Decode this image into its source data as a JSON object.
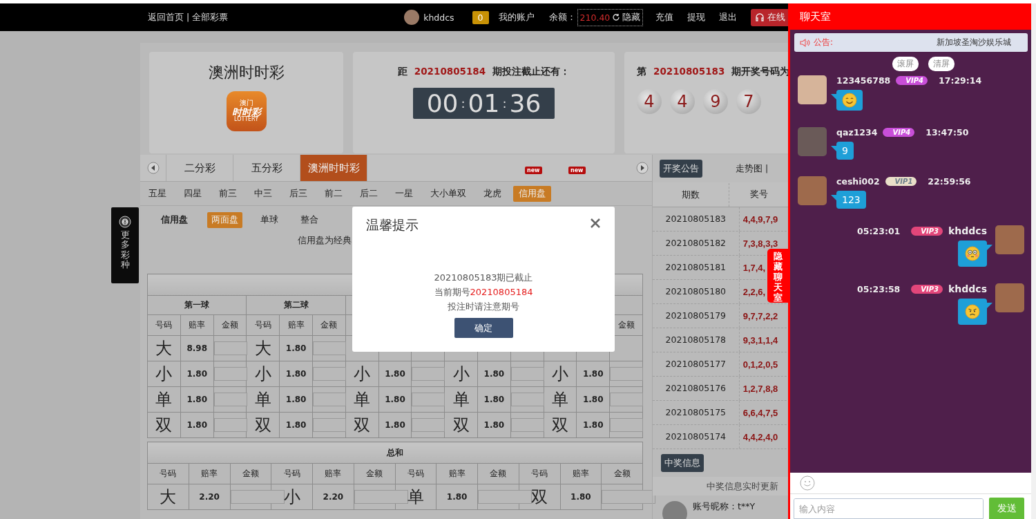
{
  "topbar": {
    "links": "返回首页 | 全部彩票",
    "username": "khddcs",
    "message_count": "0",
    "account_menu": "我的账户",
    "balance_label": "余额：",
    "balance": "210.40",
    "hide_balance": "隐藏",
    "actions": [
      "充值",
      "提现",
      "退出"
    ],
    "service_button": "在线"
  },
  "side_float": {
    "label": "更多彩种"
  },
  "game": {
    "name": "澳洲时时彩",
    "logo": {
      "top": "澳门",
      "main": "时时彩",
      "sub": "LOTTERY"
    }
  },
  "countdown": {
    "prefix": "距",
    "period": "20210805184",
    "suffix": "期投注截止还有：",
    "timer": [
      {
        "kind": "digits",
        "text": "00"
      },
      {
        "kind": "colon",
        "text": ":"
      },
      {
        "kind": "digits",
        "text": "01"
      },
      {
        "kind": "colon",
        "text": ":"
      },
      {
        "kind": "digits",
        "text": "36"
      }
    ]
  },
  "last_draw": {
    "prefix": "第",
    "period": "20210805183",
    "suffix": "期开奖号码为",
    "balls": [
      "4",
      "4",
      "9",
      "7"
    ]
  },
  "lottery_tabs": [
    {
      "label": "二分彩",
      "selected": false
    },
    {
      "label": "五分彩",
      "selected": false
    },
    {
      "label": "澳洲时时彩",
      "selected": true
    }
  ],
  "new_badges": [
    "new",
    "new"
  ],
  "play_tabs": [
    {
      "label": "五星",
      "selected": false
    },
    {
      "label": "四星",
      "selected": false
    },
    {
      "label": "前三",
      "selected": false
    },
    {
      "label": "中三",
      "selected": false
    },
    {
      "label": "后三",
      "selected": false
    },
    {
      "label": "前二",
      "selected": false
    },
    {
      "label": "后二",
      "selected": false
    },
    {
      "label": "一星",
      "selected": false
    },
    {
      "label": "大小单双",
      "selected": false
    },
    {
      "label": "龙虎",
      "selected": false
    },
    {
      "label": "信用盘",
      "selected": true
    }
  ],
  "sub_tabs": {
    "label": "信用盘",
    "items": [
      {
        "label": "两面盘",
        "selected": true
      },
      {
        "label": "单球",
        "selected": false
      },
      {
        "label": "整合",
        "selected": false
      }
    ]
  },
  "notice": "信用盘为经典",
  "ball_table": {
    "groups": [
      {
        "title": "第一球",
        "headers": [
          "号码",
          "赔率",
          "金额"
        ]
      },
      {
        "title": "第二球",
        "headers": [
          "号码",
          "赔率",
          "金额"
        ]
      }
    ],
    "trailing_header": "金额",
    "rows": [
      {
        "cells": [
          {
            "code": "大",
            "odds": "8.98"
          },
          {
            "code": "大",
            "odds": "1.80"
          },
          null,
          null,
          null
        ]
      },
      {
        "cells": [
          {
            "code": "小",
            "odds": "1.80"
          },
          {
            "code": "小",
            "odds": "1.80"
          },
          {
            "code": "小",
            "odds": "1.80"
          },
          {
            "code": "小",
            "odds": "1.80"
          },
          {
            "code": "小",
            "odds": "1.80"
          }
        ]
      },
      {
        "cells": [
          {
            "code": "单",
            "odds": "1.80"
          },
          {
            "code": "单",
            "odds": "1.80"
          },
          {
            "code": "单",
            "odds": "1.80"
          },
          {
            "code": "单",
            "odds": "1.80"
          },
          {
            "code": "单",
            "odds": "1.80"
          }
        ]
      },
      {
        "cells": [
          {
            "code": "双",
            "odds": "1.80"
          },
          {
            "code": "双",
            "odds": "1.80"
          },
          {
            "code": "双",
            "odds": "1.80"
          },
          {
            "code": "双",
            "odds": "1.80"
          },
          {
            "code": "双",
            "odds": "1.80"
          }
        ]
      }
    ]
  },
  "sum_table": {
    "title": "总和",
    "groups": [
      {
        "headers": [
          "号码",
          "赔率",
          "金额"
        ]
      },
      {
        "headers": [
          "号码",
          "赔率",
          "金额"
        ]
      },
      {
        "headers": [
          "号码",
          "赔率",
          "金额"
        ]
      },
      {
        "headers": [
          "号码",
          "赔率",
          "金额"
        ]
      }
    ],
    "cells": [
      {
        "code": "大",
        "odds": "2.20"
      },
      {
        "code": "小",
        "odds": "2.20"
      },
      {
        "code": "单",
        "odds": "1.80"
      },
      {
        "code": "双",
        "odds": "1.80"
      }
    ]
  },
  "draw_panel": {
    "button": "开奖公告",
    "trend_link": "走势图 |",
    "columns": [
      "期数",
      "奖号"
    ],
    "rows": [
      {
        "period": "20210805183",
        "numbers": "4,4,9,7,9"
      },
      {
        "period": "20210805182",
        "numbers": "7,3,8,3,3"
      },
      {
        "period": "20210805181",
        "numbers": "1,7,4,"
      },
      {
        "period": "20210805180",
        "numbers": "2,2,6,"
      },
      {
        "period": "20210805179",
        "numbers": "9,7,7,2,2"
      },
      {
        "period": "20210805178",
        "numbers": "9,3,1,1,4"
      },
      {
        "period": "20210805177",
        "numbers": "0,1,2,0,5"
      },
      {
        "period": "20210805176",
        "numbers": "1,2,7,8,8"
      },
      {
        "period": "20210805175",
        "numbers": "6,6,4,7,5"
      },
      {
        "period": "20210805174",
        "numbers": "4,4,2,4,0"
      }
    ]
  },
  "winners": {
    "button": "中奖信息",
    "subtitle": "中奖信息实时更新",
    "entries": [
      {
        "nickname": "账号昵称：t**Y"
      }
    ]
  },
  "chat": {
    "title": "聊天室",
    "notice_label": "公告:",
    "notice_text": "新加坡圣淘沙娱乐城",
    "controls": [
      "滚屏",
      "清屏"
    ],
    "messages": [
      {
        "name": "123456788",
        "vip": "VIP4",
        "color": "#c84fd8",
        "time": "17:29:14",
        "self": false,
        "kind": "smile"
      },
      {
        "name": "qaz1234",
        "vip": "VIP4",
        "color": "#c84fd8",
        "time": "13:47:50",
        "self": false,
        "kind": "text",
        "text": "9"
      },
      {
        "name": "ceshi002",
        "vip": "VIP1",
        "color": "#eadfc9",
        "time": "22:59:56",
        "self": false,
        "kind": "text",
        "text": "123"
      },
      {
        "name": "khddcs",
        "vip": "VIP3",
        "color": "#e2467a",
        "time": "05:23:01",
        "self": true,
        "kind": "flushed"
      },
      {
        "name": "khddcs",
        "vip": "VIP3",
        "color": "#e2467a",
        "time": "05:23:58",
        "self": true,
        "kind": "angry"
      }
    ],
    "input_placeholder": "输入内容",
    "send_button": "发送",
    "hide_tab": "隐藏聊天室"
  },
  "modal": {
    "title": "温馨提示",
    "lines": [
      {
        "text": "20210805183期已截止"
      },
      {
        "text": "当前期号",
        "highlight": "20210805184"
      },
      {
        "text": "投注时请注意期号"
      }
    ],
    "confirm": "确定"
  }
}
